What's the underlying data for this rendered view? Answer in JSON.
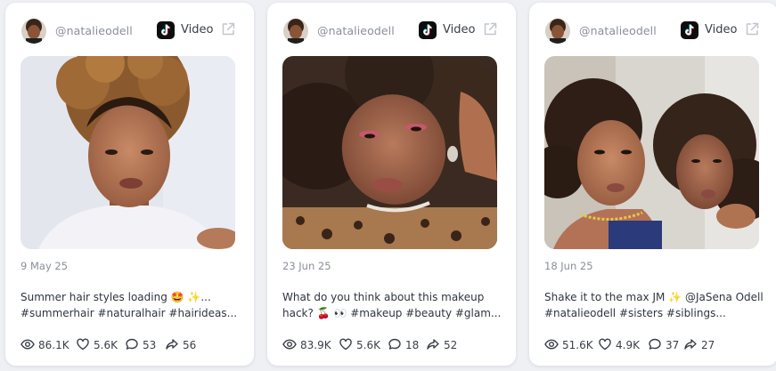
{
  "colors": {
    "accent_red": "#fe2c55",
    "accent_cyan": "#25f4ee",
    "icon_gray": "#7a7f89"
  },
  "posts": [
    {
      "handle": "@natalieodell",
      "platform_icon": "tiktok-icon",
      "platform_label": "Video",
      "date": "9 May 25",
      "caption_line1": "Summer hair styles loading 🤩 ✨...",
      "caption_line2": "#summerhair #naturalhair #hairideas...",
      "views": "86.1K",
      "likes": "5.6K",
      "comments": "53",
      "shares": "56"
    },
    {
      "handle": "@natalieodell",
      "platform_icon": "tiktok-icon",
      "platform_label": "Video",
      "date": "23 Jun 25",
      "caption_line1": "What do you think about this makeup",
      "caption_line2": "hack? 🍒 👀 #makeup #beauty #glam...",
      "views": "83.9K",
      "likes": "5.6K",
      "comments": "18",
      "shares": "52"
    },
    {
      "handle": "@natalieodell",
      "platform_icon": "tiktok-icon",
      "platform_label": "Video",
      "date": "18 Jun 25",
      "caption_line1": "Shake it to the max JM ✨ @JaSena Odell",
      "caption_line2": "#natalieodell #sisters #siblings...",
      "views": "51.6K",
      "likes": "4.9K",
      "comments": "37",
      "shares": "27"
    }
  ]
}
